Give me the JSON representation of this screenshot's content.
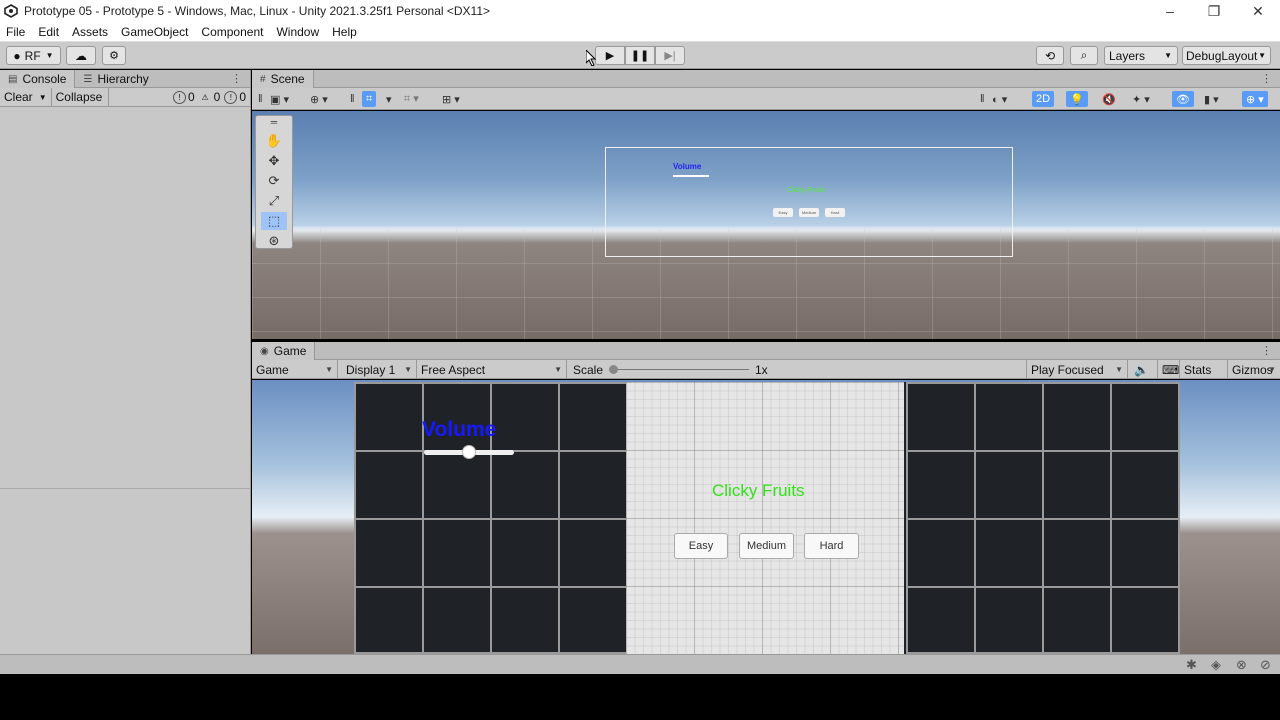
{
  "window": {
    "title": "Prototype 05 - Prototype 5 - Windows, Mac, Linux - Unity 2021.3.25f1 Personal <DX11>",
    "controls": [
      "–",
      "❐",
      "✕"
    ]
  },
  "menu": [
    "File",
    "Edit",
    "Assets",
    "GameObject",
    "Component",
    "Window",
    "Help"
  ],
  "toolbar": {
    "account_label": "RF",
    "layers_label": "Layers",
    "layout_label": "DebugLayout"
  },
  "left_panel": {
    "tabs": [
      "Console",
      "Hierarchy"
    ],
    "console": {
      "clear_label": "Clear",
      "collapse_label": "Collapse",
      "error_count": "0",
      "warning_count": "0",
      "info_count": "0"
    }
  },
  "scene": {
    "tab_label": "Scene",
    "mode_2d_label": "2D",
    "overlay": {
      "volume_label": "Volume",
      "title": "Clicky Fruits",
      "buttons": [
        "Easy",
        "Medium",
        "Hard"
      ]
    }
  },
  "game": {
    "tab_label": "Game",
    "view_mode": "Game",
    "display": "Display 1",
    "aspect": "Free Aspect",
    "scale_label": "Scale",
    "scale_value": "1x",
    "play_mode": "Play Focused",
    "stats_label": "Stats",
    "gizmos_label": "Gizmos",
    "ui": {
      "volume_label": "Volume",
      "volume_level": 0.5,
      "title": "Clicky Fruits",
      "buttons": [
        "Easy",
        "Medium",
        "Hard"
      ]
    }
  },
  "colors": {
    "volume_text": "#1818ff",
    "title_text": "#33e01a",
    "accent_blue": "#5a9bf5"
  }
}
